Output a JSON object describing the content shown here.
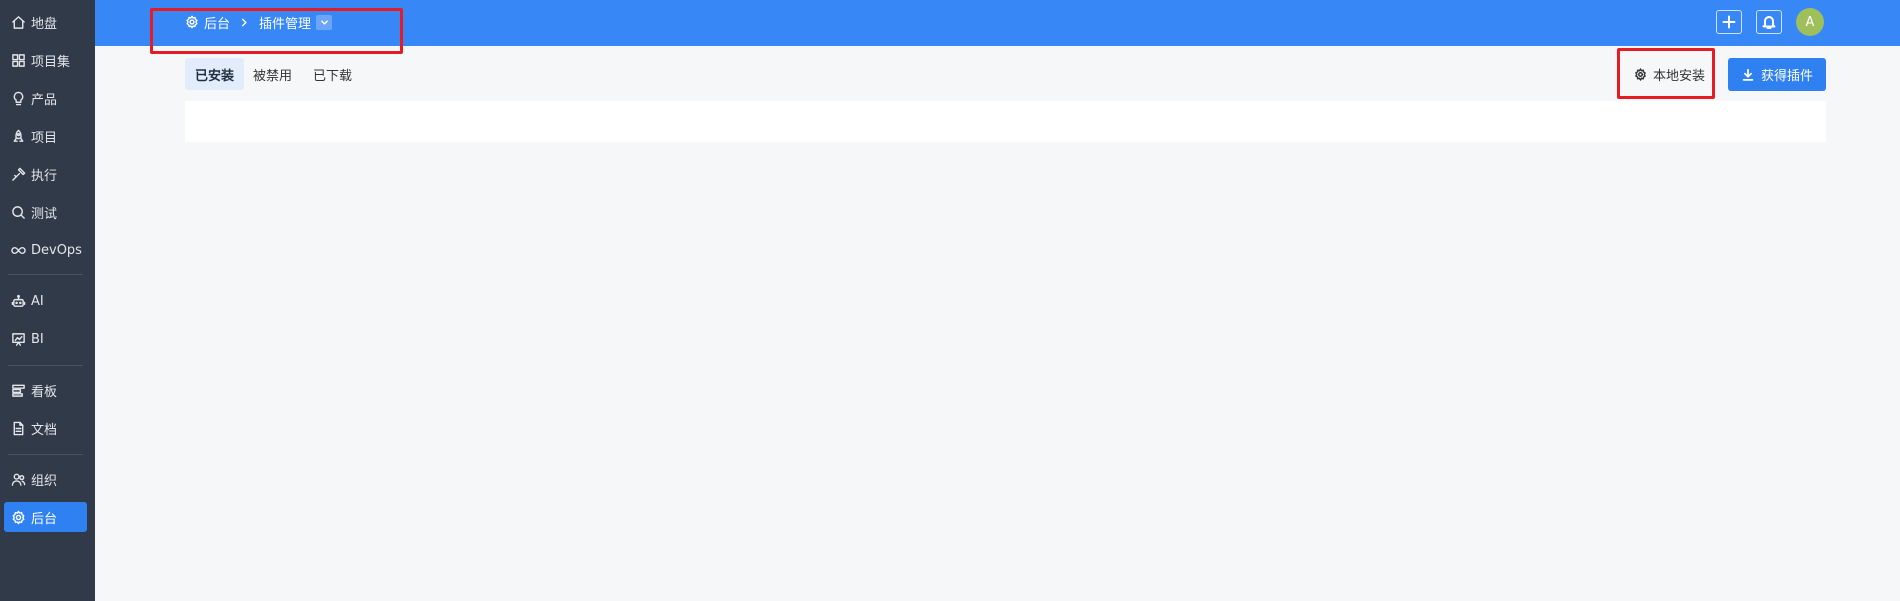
{
  "sidebar": {
    "items": [
      {
        "label": "地盘",
        "icon": "home-icon"
      },
      {
        "label": "项目集",
        "icon": "grid-icon"
      },
      {
        "label": "产品",
        "icon": "lightbulb-icon"
      },
      {
        "label": "项目",
        "icon": "rocket-icon"
      },
      {
        "label": "执行",
        "icon": "hammer-icon"
      },
      {
        "label": "测试",
        "icon": "search-icon"
      },
      {
        "label": "DevOps",
        "icon": "infinity-icon"
      },
      {
        "label": "AI",
        "icon": "robot-icon"
      },
      {
        "label": "BI",
        "icon": "chart-icon"
      },
      {
        "label": "看板",
        "icon": "kanban-icon"
      },
      {
        "label": "文档",
        "icon": "document-icon"
      },
      {
        "label": "组织",
        "icon": "users-icon"
      },
      {
        "label": "后台",
        "icon": "gear-icon",
        "active": true
      }
    ]
  },
  "header": {
    "breadcrumb": {
      "root": "后台",
      "current": "插件管理"
    },
    "avatar_initial": "A",
    "colors": {
      "bar": "#3887f6",
      "accent": "#2f80f1",
      "avatar": "#9fbf5b"
    }
  },
  "tabs": [
    {
      "label": "已安装",
      "active": true
    },
    {
      "label": "被禁用"
    },
    {
      "label": "已下载"
    }
  ],
  "actions": {
    "local_install": "本地安装",
    "get_plugin": "获得插件"
  }
}
